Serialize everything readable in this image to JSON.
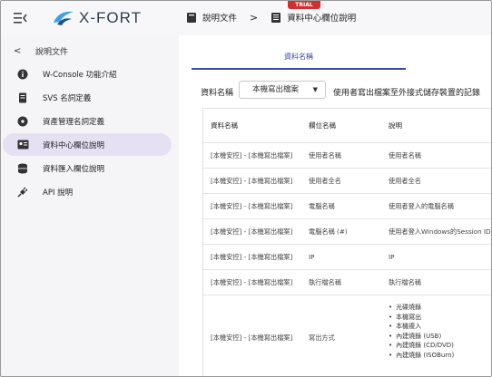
{
  "header": {
    "logo_text": "X-FORT",
    "trial_badge": "TRIAL",
    "breadcrumb": [
      "說明文件",
      "資料中心欄位說明"
    ],
    "breadcrumb_sep": ">"
  },
  "sidebar": {
    "back_label": "說明文件",
    "items": [
      {
        "label": "W-Console 功能介紹",
        "icon": "info-icon",
        "active": false
      },
      {
        "label": "SVS 名詞定義",
        "icon": "file-icon",
        "active": false
      },
      {
        "label": "資產管理名詞定義",
        "icon": "disc-icon",
        "active": false
      },
      {
        "label": "資料中心欄位說明",
        "icon": "id-card-icon",
        "active": true
      },
      {
        "label": "資料匯入欄位說明",
        "icon": "database-icon",
        "active": false
      },
      {
        "label": "API 說明",
        "icon": "plug-icon",
        "active": false
      }
    ]
  },
  "main": {
    "tab_label": "資料名稱",
    "filter_label": "資料名稱",
    "select_value": "本機寫出檔案",
    "filter_desc": "使用者寫出檔案至外接式儲存裝置的記錄",
    "table": {
      "headers": [
        "資料名稱",
        "欄位名稱",
        "說明"
      ],
      "rows": [
        [
          "[本機安控] - [本機寫出檔案]",
          "使用者名稱",
          "使用者名稱"
        ],
        [
          "[本機安控] - [本機寫出檔案]",
          "使用者全名",
          "使用者全名"
        ],
        [
          "[本機安控] - [本機寫出檔案]",
          "電腦名稱",
          "使用者登入的電腦名稱"
        ],
        [
          "[本機安控] - [本機寫出檔案]",
          "電腦名稱 (#)",
          "使用者登入Windows的Session ID"
        ],
        [
          "[本機安控] - [本機寫出檔案]",
          "IP",
          "IP"
        ],
        [
          "[本機安控] - [本機寫出檔案]",
          "執行檔名稱",
          "執行檔名稱"
        ],
        [
          "[本機安控] - [本機寫出檔案]",
          "寫出方式",
          ""
        ]
      ],
      "write_methods": [
        "光碟燒錄",
        "本機寫出",
        "本機複入",
        "內建燒錄 (USB)",
        "內建燒錄 (CD/DVD)",
        "內建燒錄 (ISOBurn)"
      ]
    }
  },
  "colors": {
    "accent": "#3a4aa8",
    "active_bg": "#e5e1f3",
    "trial": "#d32f2f",
    "logo_blue": "#3aa0e8"
  }
}
